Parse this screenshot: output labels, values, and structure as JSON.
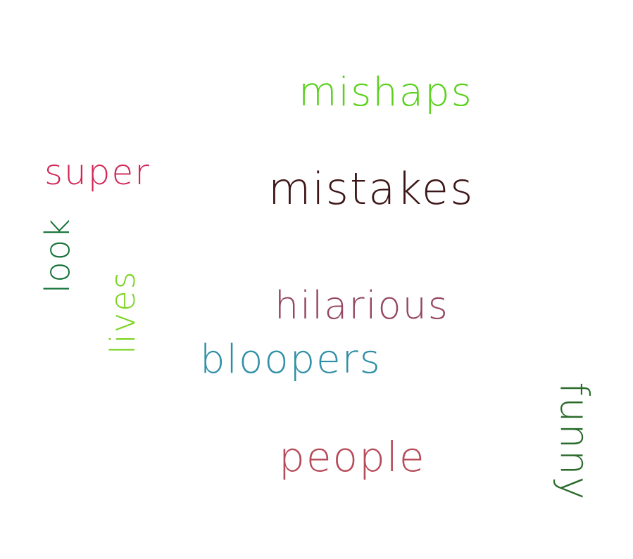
{
  "words": [
    {
      "text": "mishaps",
      "color": "#5ad11c",
      "rotation": 0
    },
    {
      "text": "mistakes",
      "color": "#3d1618",
      "rotation": 0
    },
    {
      "text": "super",
      "color": "#d22556",
      "rotation": 0
    },
    {
      "text": "look",
      "color": "#127236",
      "rotation": -90
    },
    {
      "text": "lives",
      "color": "#7ad321",
      "rotation": -90
    },
    {
      "text": "hilarious",
      "color": "#94475f",
      "rotation": 0
    },
    {
      "text": "bloopers",
      "color": "#2f8fa6",
      "rotation": 0
    },
    {
      "text": "people",
      "color": "#b64a57",
      "rotation": 0
    },
    {
      "text": "funny",
      "color": "#2a6b2b",
      "rotation": 90
    }
  ]
}
